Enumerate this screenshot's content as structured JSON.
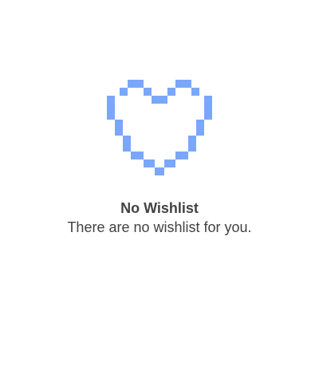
{
  "empty_state": {
    "icon": "heart-outline-icon",
    "title": "No Wishlist",
    "message": "There are no wishlist for you."
  },
  "colors": {
    "background": "#ffffff",
    "icon": "#7aa7fb",
    "text": "#424242"
  }
}
